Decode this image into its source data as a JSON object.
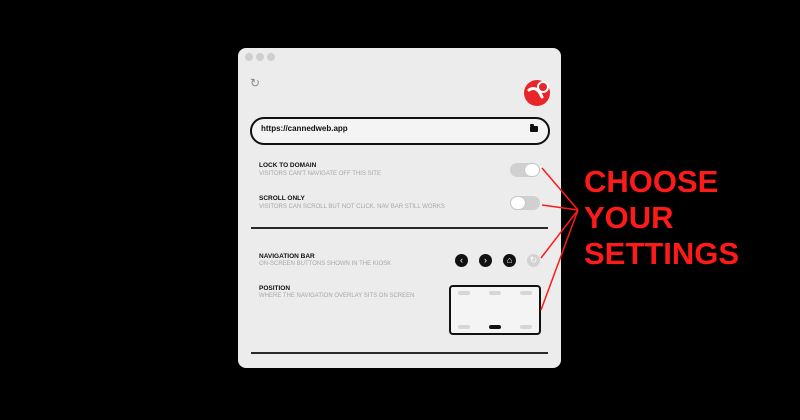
{
  "window": {
    "url": {
      "value": "https://cannedweb.app"
    },
    "settings": [
      {
        "title": "LOCK TO DOMAIN",
        "subtitle": "VISITORS CAN'T NAVIGATE OFF THIS SITE",
        "enabled": true
      },
      {
        "title": "SCROLL ONLY",
        "subtitle": "VISITORS CAN SCROLL BUT NOT CLICK. NAV BAR STILL WORKS",
        "enabled": false
      }
    ],
    "navigation_bar": {
      "title": "NAVIGATION BAR",
      "subtitle": "ON-SCREEN BUTTONS SHOWN IN THE KIOSK",
      "buttons": [
        {
          "icon": "back-icon",
          "glyph": "‹",
          "enabled": true
        },
        {
          "icon": "forward-icon",
          "glyph": "›",
          "enabled": true
        },
        {
          "icon": "home-icon",
          "glyph": "⌂",
          "enabled": true
        },
        {
          "icon": "reload-icon",
          "glyph": "↻",
          "enabled": false
        }
      ]
    },
    "position": {
      "title": "POSITION",
      "subtitle": "WHERE THE NAVIGATION OVERLAY SITS ON SCREEN",
      "selected": "bottom-center"
    },
    "icons": {
      "reload": "↻"
    }
  },
  "annotation": {
    "lines": [
      "CHOOSE",
      "YOUR",
      "SETTINGS"
    ],
    "color": "#ff1a1a"
  },
  "colors": {
    "accent": "#e8262a",
    "toggle_off": "#d0d0d0",
    "background": "#000000",
    "panel": "#ececec"
  }
}
